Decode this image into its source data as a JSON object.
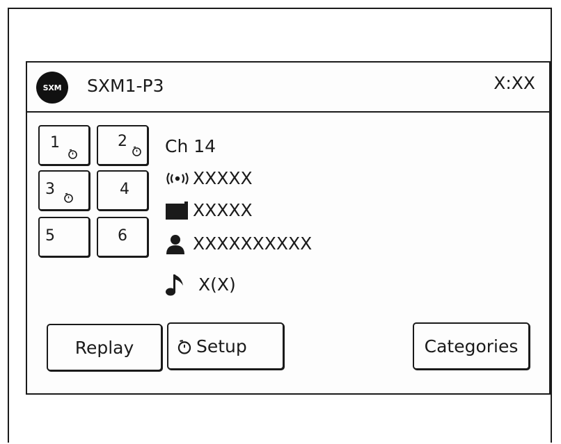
{
  "header": {
    "logo_text": "SXM",
    "channel_title": "SXM1-P3",
    "clock": "X:XX"
  },
  "presets": [
    {
      "label": "1",
      "has_alert": true
    },
    {
      "label": "2",
      "has_alert": true
    },
    {
      "label": "3",
      "has_alert": true
    },
    {
      "label": "4",
      "has_alert": false
    },
    {
      "label": "5",
      "has_alert": false
    },
    {
      "label": "6",
      "has_alert": false
    }
  ],
  "info": {
    "channel": "Ch 14",
    "station": "XXXXX",
    "category": "XXXXX",
    "artist": "XXXXXXXXXX",
    "song": "X(X)"
  },
  "icons": {
    "station": "broadcast-signal-icon",
    "category": "folder-icon",
    "artist": "person-icon",
    "song": "music-note-icon",
    "alert": "alarm-clock-icon"
  },
  "buttons": {
    "replay": "Replay",
    "setup": "Setup",
    "categories": "Categories"
  }
}
